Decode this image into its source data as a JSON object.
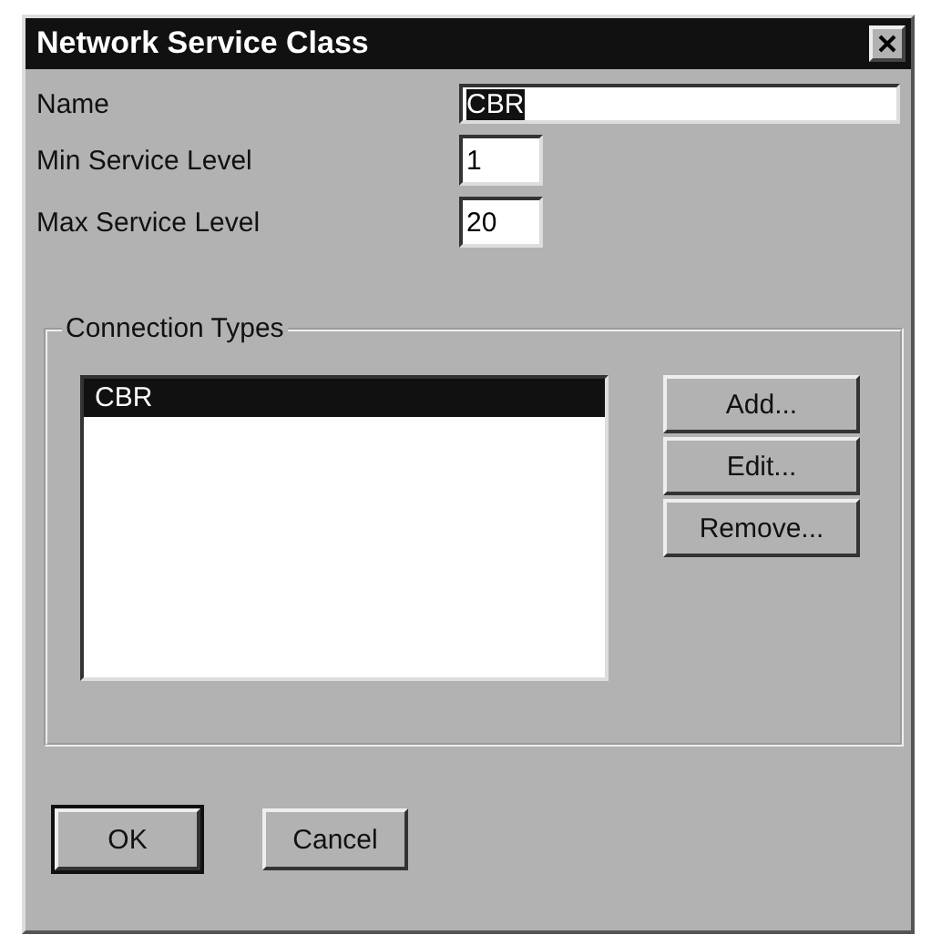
{
  "window": {
    "title": "Network Service Class"
  },
  "fields": [
    {
      "label": "Name",
      "value": "CBR",
      "highlighted": true,
      "kind": "wide"
    },
    {
      "label": "Min Service Level",
      "value": "1",
      "highlighted": false,
      "kind": "short"
    },
    {
      "label": "Max Service Level",
      "value": "20",
      "highlighted": false,
      "kind": "short"
    }
  ],
  "connection_types": {
    "title": "Connection Types",
    "items": [
      {
        "label": "CBR",
        "selected": true
      }
    ],
    "buttons": [
      "Add...",
      "Edit...",
      "Remove..."
    ]
  },
  "buttons": [
    {
      "label": "OK",
      "default": true
    },
    {
      "label": "Cancel",
      "default": false
    }
  ]
}
